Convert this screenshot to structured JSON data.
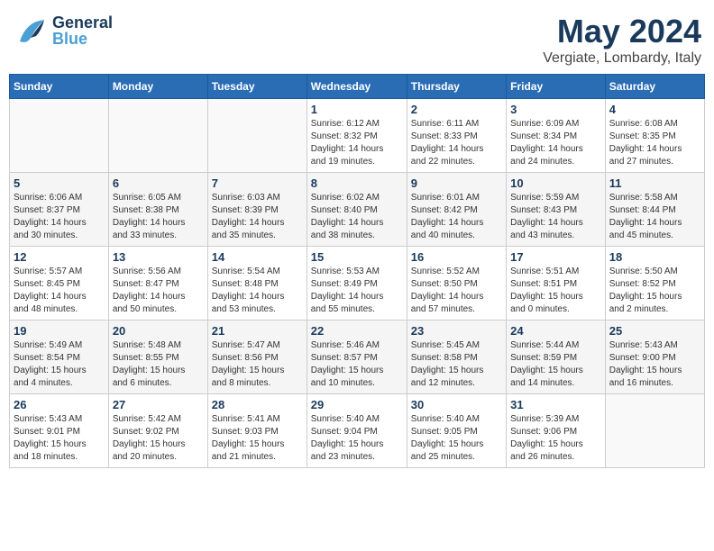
{
  "logo": {
    "general": "General",
    "blue": "Blue"
  },
  "title": "May 2024",
  "location": "Vergiate, Lombardy, Italy",
  "days_of_week": [
    "Sunday",
    "Monday",
    "Tuesday",
    "Wednesday",
    "Thursday",
    "Friday",
    "Saturday"
  ],
  "weeks": [
    [
      {
        "day": "",
        "info": ""
      },
      {
        "day": "",
        "info": ""
      },
      {
        "day": "",
        "info": ""
      },
      {
        "day": "1",
        "info": "Sunrise: 6:12 AM\nSunset: 8:32 PM\nDaylight: 14 hours\nand 19 minutes."
      },
      {
        "day": "2",
        "info": "Sunrise: 6:11 AM\nSunset: 8:33 PM\nDaylight: 14 hours\nand 22 minutes."
      },
      {
        "day": "3",
        "info": "Sunrise: 6:09 AM\nSunset: 8:34 PM\nDaylight: 14 hours\nand 24 minutes."
      },
      {
        "day": "4",
        "info": "Sunrise: 6:08 AM\nSunset: 8:35 PM\nDaylight: 14 hours\nand 27 minutes."
      }
    ],
    [
      {
        "day": "5",
        "info": "Sunrise: 6:06 AM\nSunset: 8:37 PM\nDaylight: 14 hours\nand 30 minutes."
      },
      {
        "day": "6",
        "info": "Sunrise: 6:05 AM\nSunset: 8:38 PM\nDaylight: 14 hours\nand 33 minutes."
      },
      {
        "day": "7",
        "info": "Sunrise: 6:03 AM\nSunset: 8:39 PM\nDaylight: 14 hours\nand 35 minutes."
      },
      {
        "day": "8",
        "info": "Sunrise: 6:02 AM\nSunset: 8:40 PM\nDaylight: 14 hours\nand 38 minutes."
      },
      {
        "day": "9",
        "info": "Sunrise: 6:01 AM\nSunset: 8:42 PM\nDaylight: 14 hours\nand 40 minutes."
      },
      {
        "day": "10",
        "info": "Sunrise: 5:59 AM\nSunset: 8:43 PM\nDaylight: 14 hours\nand 43 minutes."
      },
      {
        "day": "11",
        "info": "Sunrise: 5:58 AM\nSunset: 8:44 PM\nDaylight: 14 hours\nand 45 minutes."
      }
    ],
    [
      {
        "day": "12",
        "info": "Sunrise: 5:57 AM\nSunset: 8:45 PM\nDaylight: 14 hours\nand 48 minutes."
      },
      {
        "day": "13",
        "info": "Sunrise: 5:56 AM\nSunset: 8:47 PM\nDaylight: 14 hours\nand 50 minutes."
      },
      {
        "day": "14",
        "info": "Sunrise: 5:54 AM\nSunset: 8:48 PM\nDaylight: 14 hours\nand 53 minutes."
      },
      {
        "day": "15",
        "info": "Sunrise: 5:53 AM\nSunset: 8:49 PM\nDaylight: 14 hours\nand 55 minutes."
      },
      {
        "day": "16",
        "info": "Sunrise: 5:52 AM\nSunset: 8:50 PM\nDaylight: 14 hours\nand 57 minutes."
      },
      {
        "day": "17",
        "info": "Sunrise: 5:51 AM\nSunset: 8:51 PM\nDaylight: 15 hours\nand 0 minutes."
      },
      {
        "day": "18",
        "info": "Sunrise: 5:50 AM\nSunset: 8:52 PM\nDaylight: 15 hours\nand 2 minutes."
      }
    ],
    [
      {
        "day": "19",
        "info": "Sunrise: 5:49 AM\nSunset: 8:54 PM\nDaylight: 15 hours\nand 4 minutes."
      },
      {
        "day": "20",
        "info": "Sunrise: 5:48 AM\nSunset: 8:55 PM\nDaylight: 15 hours\nand 6 minutes."
      },
      {
        "day": "21",
        "info": "Sunrise: 5:47 AM\nSunset: 8:56 PM\nDaylight: 15 hours\nand 8 minutes."
      },
      {
        "day": "22",
        "info": "Sunrise: 5:46 AM\nSunset: 8:57 PM\nDaylight: 15 hours\nand 10 minutes."
      },
      {
        "day": "23",
        "info": "Sunrise: 5:45 AM\nSunset: 8:58 PM\nDaylight: 15 hours\nand 12 minutes."
      },
      {
        "day": "24",
        "info": "Sunrise: 5:44 AM\nSunset: 8:59 PM\nDaylight: 15 hours\nand 14 minutes."
      },
      {
        "day": "25",
        "info": "Sunrise: 5:43 AM\nSunset: 9:00 PM\nDaylight: 15 hours\nand 16 minutes."
      }
    ],
    [
      {
        "day": "26",
        "info": "Sunrise: 5:43 AM\nSunset: 9:01 PM\nDaylight: 15 hours\nand 18 minutes."
      },
      {
        "day": "27",
        "info": "Sunrise: 5:42 AM\nSunset: 9:02 PM\nDaylight: 15 hours\nand 20 minutes."
      },
      {
        "day": "28",
        "info": "Sunrise: 5:41 AM\nSunset: 9:03 PM\nDaylight: 15 hours\nand 21 minutes."
      },
      {
        "day": "29",
        "info": "Sunrise: 5:40 AM\nSunset: 9:04 PM\nDaylight: 15 hours\nand 23 minutes."
      },
      {
        "day": "30",
        "info": "Sunrise: 5:40 AM\nSunset: 9:05 PM\nDaylight: 15 hours\nand 25 minutes."
      },
      {
        "day": "31",
        "info": "Sunrise: 5:39 AM\nSunset: 9:06 PM\nDaylight: 15 hours\nand 26 minutes."
      },
      {
        "day": "",
        "info": ""
      }
    ]
  ]
}
